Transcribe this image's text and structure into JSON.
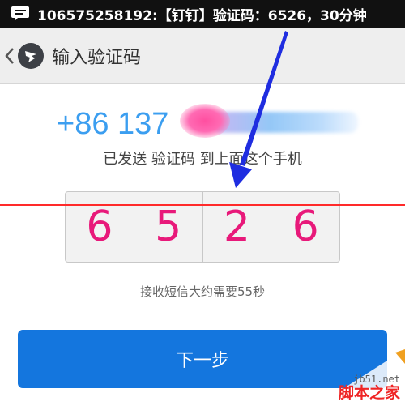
{
  "notification": {
    "text": "106575258192:【钉钉】验证码：6526，30分钟",
    "icon": "message-icon"
  },
  "header": {
    "back_icon": "chevron-left-icon",
    "logo_icon": "dingtalk-logo-icon",
    "title": "输入验证码"
  },
  "phone": {
    "prefix": "+86 137"
  },
  "subtitle": "已发送 验证码 到上面这个手机",
  "code": {
    "digits": [
      "6",
      "5",
      "2",
      "6"
    ]
  },
  "hint": "接收短信大约需要55秒",
  "next_button": "下一步",
  "watermark": {
    "url": "jb51.net",
    "name": "脚本之家"
  },
  "colors": {
    "accent_blue": "#1476de",
    "phone_blue": "#3b9ef0",
    "digit_pink": "#e8197a",
    "red_line": "#ff2a2a",
    "arrow_blue": "#1f2de0"
  }
}
